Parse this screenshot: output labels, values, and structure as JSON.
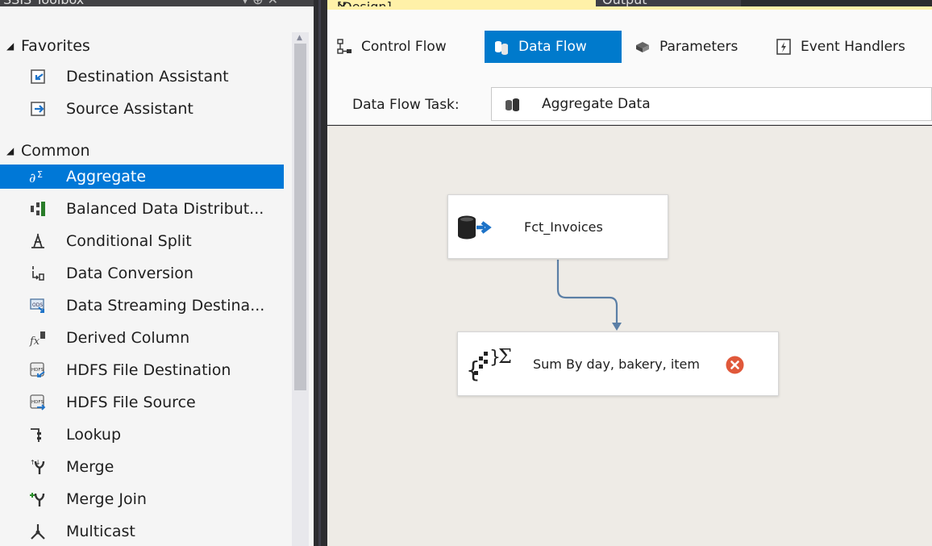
{
  "toolbox": {
    "title": "SSIS Toolbox",
    "title_controls": "▾ ⊕ ✕",
    "groups": [
      {
        "label": "Favorites",
        "items": [
          {
            "label": "Destination Assistant",
            "icon": "destination-assistant-icon"
          },
          {
            "label": "Source Assistant",
            "icon": "source-assistant-icon"
          }
        ]
      },
      {
        "label": "Common",
        "items": [
          {
            "label": "Aggregate",
            "icon": "aggregate-icon",
            "selected": true
          },
          {
            "label": "Balanced Data Distribut...",
            "icon": "balanced-distributor-icon"
          },
          {
            "label": "Conditional Split",
            "icon": "conditional-split-icon"
          },
          {
            "label": "Data Conversion",
            "icon": "data-conversion-icon"
          },
          {
            "label": "Data Streaming Destina...",
            "icon": "data-streaming-icon"
          },
          {
            "label": "Derived Column",
            "icon": "derived-column-icon"
          },
          {
            "label": "HDFS File Destination",
            "icon": "hdfs-destination-icon"
          },
          {
            "label": "HDFS File Source",
            "icon": "hdfs-source-icon"
          },
          {
            "label": "Lookup",
            "icon": "lookup-icon"
          },
          {
            "label": "Merge",
            "icon": "merge-icon"
          },
          {
            "label": "Merge Join",
            "icon": "merge-join-icon"
          },
          {
            "label": "Multicast",
            "icon": "multicast-icon"
          }
        ]
      }
    ]
  },
  "tabs": {
    "document": "Package.dtsx [Design]",
    "document_controls": "⊕ ✕",
    "output": "Output"
  },
  "designer": {
    "tabs": [
      {
        "label": "Control Flow",
        "icon": "control-flow-icon",
        "active": false
      },
      {
        "label": "Data Flow",
        "icon": "data-flow-icon",
        "active": true
      },
      {
        "label": "Parameters",
        "icon": "parameters-icon",
        "active": false
      },
      {
        "label": "Event Handlers",
        "icon": "event-handlers-icon",
        "active": false
      }
    ],
    "task_label": "Data Flow Task:",
    "task_value": "Aggregate Data"
  },
  "canvas": {
    "source_node": {
      "label": "Fct_Invoices",
      "icon": "database-source-icon"
    },
    "aggregate_node": {
      "label": "Sum By day, bakery, item",
      "icon": "aggregate-icon",
      "status": "error",
      "status_icon": "error-icon"
    }
  },
  "colors": {
    "selection": "#0078d7",
    "active_tab": "#007acc",
    "doc_tab": "#fff1a8",
    "canvas": "#eeebe6",
    "connector": "#5b7fa6",
    "error": "#e0583a"
  }
}
